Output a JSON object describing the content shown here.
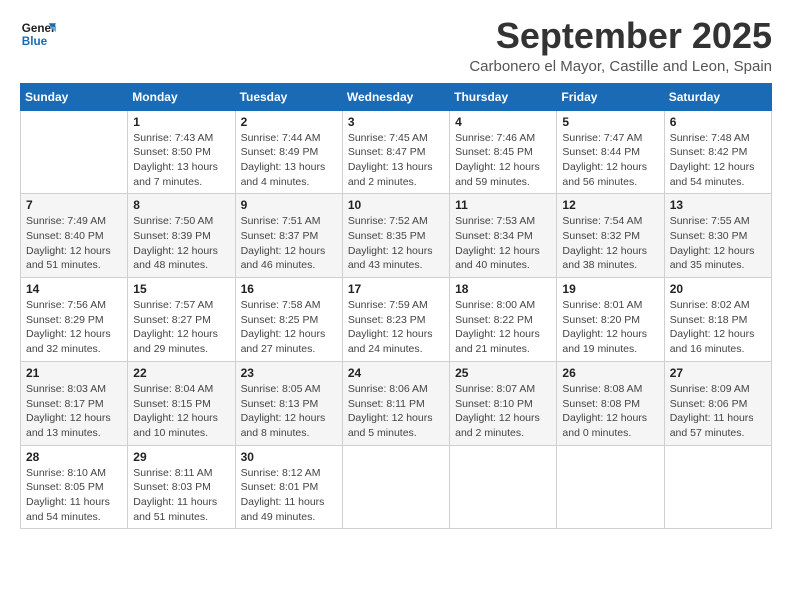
{
  "logo": {
    "line1": "General",
    "line2": "Blue"
  },
  "title": "September 2025",
  "subtitle": "Carbonero el Mayor, Castille and Leon, Spain",
  "weekdays": [
    "Sunday",
    "Monday",
    "Tuesday",
    "Wednesday",
    "Thursday",
    "Friday",
    "Saturday"
  ],
  "weeks": [
    [
      {
        "day": "",
        "info": ""
      },
      {
        "day": "1",
        "info": "Sunrise: 7:43 AM\nSunset: 8:50 PM\nDaylight: 13 hours\nand 7 minutes."
      },
      {
        "day": "2",
        "info": "Sunrise: 7:44 AM\nSunset: 8:49 PM\nDaylight: 13 hours\nand 4 minutes."
      },
      {
        "day": "3",
        "info": "Sunrise: 7:45 AM\nSunset: 8:47 PM\nDaylight: 13 hours\nand 2 minutes."
      },
      {
        "day": "4",
        "info": "Sunrise: 7:46 AM\nSunset: 8:45 PM\nDaylight: 12 hours\nand 59 minutes."
      },
      {
        "day": "5",
        "info": "Sunrise: 7:47 AM\nSunset: 8:44 PM\nDaylight: 12 hours\nand 56 minutes."
      },
      {
        "day": "6",
        "info": "Sunrise: 7:48 AM\nSunset: 8:42 PM\nDaylight: 12 hours\nand 54 minutes."
      }
    ],
    [
      {
        "day": "7",
        "info": "Sunrise: 7:49 AM\nSunset: 8:40 PM\nDaylight: 12 hours\nand 51 minutes."
      },
      {
        "day": "8",
        "info": "Sunrise: 7:50 AM\nSunset: 8:39 PM\nDaylight: 12 hours\nand 48 minutes."
      },
      {
        "day": "9",
        "info": "Sunrise: 7:51 AM\nSunset: 8:37 PM\nDaylight: 12 hours\nand 46 minutes."
      },
      {
        "day": "10",
        "info": "Sunrise: 7:52 AM\nSunset: 8:35 PM\nDaylight: 12 hours\nand 43 minutes."
      },
      {
        "day": "11",
        "info": "Sunrise: 7:53 AM\nSunset: 8:34 PM\nDaylight: 12 hours\nand 40 minutes."
      },
      {
        "day": "12",
        "info": "Sunrise: 7:54 AM\nSunset: 8:32 PM\nDaylight: 12 hours\nand 38 minutes."
      },
      {
        "day": "13",
        "info": "Sunrise: 7:55 AM\nSunset: 8:30 PM\nDaylight: 12 hours\nand 35 minutes."
      }
    ],
    [
      {
        "day": "14",
        "info": "Sunrise: 7:56 AM\nSunset: 8:29 PM\nDaylight: 12 hours\nand 32 minutes."
      },
      {
        "day": "15",
        "info": "Sunrise: 7:57 AM\nSunset: 8:27 PM\nDaylight: 12 hours\nand 29 minutes."
      },
      {
        "day": "16",
        "info": "Sunrise: 7:58 AM\nSunset: 8:25 PM\nDaylight: 12 hours\nand 27 minutes."
      },
      {
        "day": "17",
        "info": "Sunrise: 7:59 AM\nSunset: 8:23 PM\nDaylight: 12 hours\nand 24 minutes."
      },
      {
        "day": "18",
        "info": "Sunrise: 8:00 AM\nSunset: 8:22 PM\nDaylight: 12 hours\nand 21 minutes."
      },
      {
        "day": "19",
        "info": "Sunrise: 8:01 AM\nSunset: 8:20 PM\nDaylight: 12 hours\nand 19 minutes."
      },
      {
        "day": "20",
        "info": "Sunrise: 8:02 AM\nSunset: 8:18 PM\nDaylight: 12 hours\nand 16 minutes."
      }
    ],
    [
      {
        "day": "21",
        "info": "Sunrise: 8:03 AM\nSunset: 8:17 PM\nDaylight: 12 hours\nand 13 minutes."
      },
      {
        "day": "22",
        "info": "Sunrise: 8:04 AM\nSunset: 8:15 PM\nDaylight: 12 hours\nand 10 minutes."
      },
      {
        "day": "23",
        "info": "Sunrise: 8:05 AM\nSunset: 8:13 PM\nDaylight: 12 hours\nand 8 minutes."
      },
      {
        "day": "24",
        "info": "Sunrise: 8:06 AM\nSunset: 8:11 PM\nDaylight: 12 hours\nand 5 minutes."
      },
      {
        "day": "25",
        "info": "Sunrise: 8:07 AM\nSunset: 8:10 PM\nDaylight: 12 hours\nand 2 minutes."
      },
      {
        "day": "26",
        "info": "Sunrise: 8:08 AM\nSunset: 8:08 PM\nDaylight: 12 hours\nand 0 minutes."
      },
      {
        "day": "27",
        "info": "Sunrise: 8:09 AM\nSunset: 8:06 PM\nDaylight: 11 hours\nand 57 minutes."
      }
    ],
    [
      {
        "day": "28",
        "info": "Sunrise: 8:10 AM\nSunset: 8:05 PM\nDaylight: 11 hours\nand 54 minutes."
      },
      {
        "day": "29",
        "info": "Sunrise: 8:11 AM\nSunset: 8:03 PM\nDaylight: 11 hours\nand 51 minutes."
      },
      {
        "day": "30",
        "info": "Sunrise: 8:12 AM\nSunset: 8:01 PM\nDaylight: 11 hours\nand 49 minutes."
      },
      {
        "day": "",
        "info": ""
      },
      {
        "day": "",
        "info": ""
      },
      {
        "day": "",
        "info": ""
      },
      {
        "day": "",
        "info": ""
      }
    ]
  ]
}
